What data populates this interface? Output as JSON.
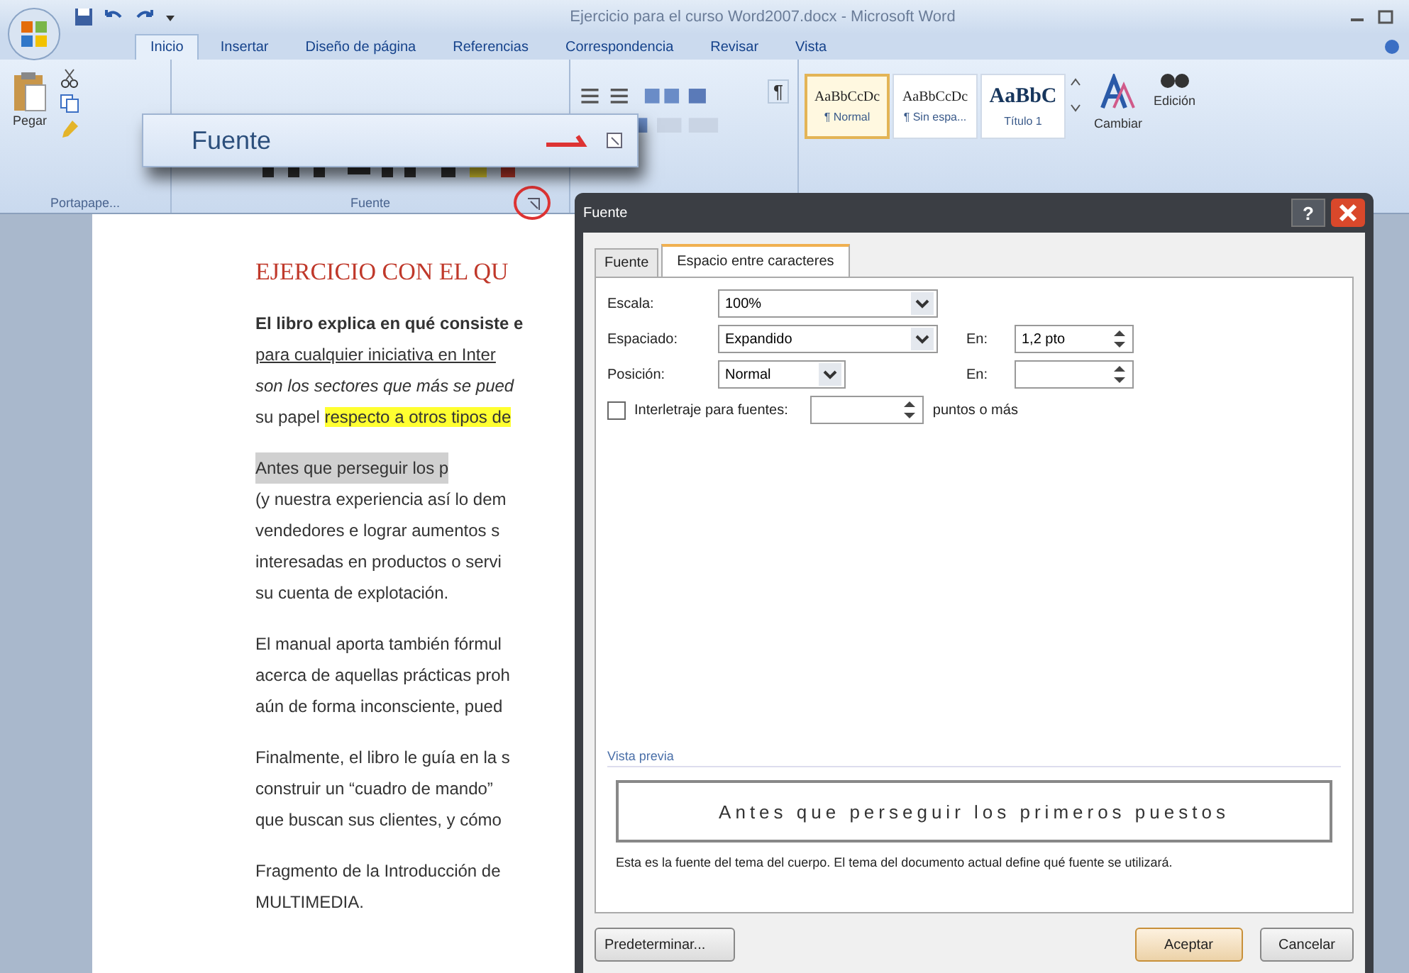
{
  "window": {
    "title": "Ejercicio para el curso Word2007.docx - Microsoft Word"
  },
  "ribbon": {
    "tabs": [
      {
        "label": "Inicio",
        "selected": true
      },
      {
        "label": "Insertar",
        "selected": false
      },
      {
        "label": "Diseño de página",
        "selected": false
      },
      {
        "label": "Referencias",
        "selected": false
      },
      {
        "label": "Correspondencia",
        "selected": false
      },
      {
        "label": "Revisar",
        "selected": false
      },
      {
        "label": "Vista",
        "selected": false
      }
    ],
    "paste_label": "Pegar",
    "clipboard_label": "Portapape...",
    "font_label": "Fuente",
    "pilcrow": "¶",
    "styles": [
      {
        "preview": "AaBbCcDc",
        "name": "¶ Normal",
        "kind": "body",
        "selected": true
      },
      {
        "preview": "AaBbCcDc",
        "name": "¶ Sin espa...",
        "kind": "body",
        "selected": false
      },
      {
        "preview": "AaBbC",
        "name": "Título 1",
        "kind": "heading",
        "selected": false
      }
    ],
    "change_styles_label": "Cambiar",
    "editing_label": "Edición"
  },
  "tooltip": {
    "title": "Fuente"
  },
  "document": {
    "paragraphs": [
      {
        "lines": [
          {
            "kind": "heading",
            "text": "EJERCICIO CON EL QU"
          }
        ]
      },
      {
        "lines": [
          {
            "kind": "bold",
            "text": "El libro explica en qué consiste e"
          },
          {
            "kind": "underline",
            "text": "para cualquier iniciativa en Inter"
          },
          {
            "kind": "italic",
            "text": "son los sectores que más se pued"
          },
          {
            "kind": "plain",
            "text": "su papel ",
            "highlight": "respecto a otros tipos de"
          }
        ]
      },
      {
        "lines": [
          {
            "kind": "shaded",
            "text": "Antes que perseguir los p"
          },
          {
            "kind": "plain",
            "text": "(y nuestra experiencia así lo dem"
          },
          {
            "kind": "plain",
            "text": "vendedores e lograr aumentos s"
          },
          {
            "kind": "plain",
            "text": "interesadas en productos o servi"
          },
          {
            "kind": "plain",
            "text": "su cuenta de explotación."
          }
        ]
      },
      {
        "lines": [
          {
            "kind": "plain",
            "text": "El manual aporta también fórmul"
          },
          {
            "kind": "plain",
            "text": "acerca de aquellas prácticas proh"
          },
          {
            "kind": "plain",
            "text": "aún de forma inconsciente, pued"
          }
        ]
      },
      {
        "lines": [
          {
            "kind": "plain",
            "text": "Finalmente, el libro le guía en la s"
          },
          {
            "kind": "plain",
            "text": "construir un “cuadro de mando”"
          },
          {
            "kind": "plain",
            "text": "que buscan sus clientes, y cómo"
          }
        ]
      },
      {
        "lines": [
          {
            "kind": "plain",
            "text": "Fragmento de la Introducción de"
          },
          {
            "kind": "plain",
            "text": "MULTIMEDIA."
          }
        ]
      }
    ]
  },
  "dialog": {
    "title": "Fuente",
    "help": "?",
    "tabs": [
      {
        "label": "Fuente",
        "selected": false
      },
      {
        "label": "Espacio entre caracteres",
        "selected": true
      }
    ],
    "rows": [
      {
        "label": "Escala:",
        "value": "100%",
        "kind": "wide"
      },
      {
        "label": "Espaciado:",
        "value": "Expandido",
        "kind": "wide",
        "spin": {
          "label": "En:",
          "value": "1,2 pto"
        }
      },
      {
        "label": "Posición:",
        "value": "Normal",
        "kind": "narrow",
        "spin": {
          "label": "En:"
        }
      }
    ],
    "kerning": {
      "label": "Interletraje para fuentes:",
      "checked": false,
      "suffix": "puntos o más"
    },
    "preview": {
      "label": "Vista previa",
      "sample": "Antes que perseguir los primeros puestos",
      "note": "Esta es la fuente del tema del cuerpo. El tema del documento actual define qué fuente se utilizará."
    },
    "buttons": [
      {
        "label": "Predeterminar...",
        "kind": "left",
        "focused": false
      },
      {
        "label": "Aceptar",
        "kind": "right",
        "focused": true
      },
      {
        "label": "Cancelar",
        "kind": "right",
        "focused": false
      }
    ]
  }
}
